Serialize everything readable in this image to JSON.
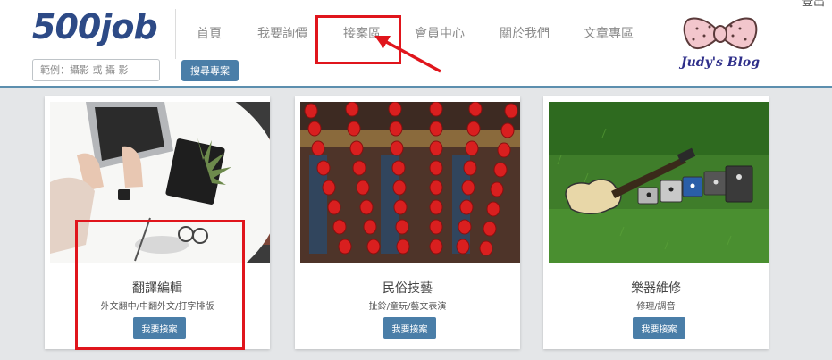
{
  "header": {
    "logo": "500job",
    "corner_text": "登出",
    "search": {
      "placeholder": "範例：攝影 或 攝 影",
      "button_label": "搜尋專案"
    },
    "nav": [
      {
        "label": "首頁"
      },
      {
        "label": "我要詢價"
      },
      {
        "label": "接案區"
      },
      {
        "label": "會員中心"
      },
      {
        "label": "關於我們"
      },
      {
        "label": "文章專區"
      }
    ],
    "blog_logo_text": "Judy's Blog"
  },
  "cards": [
    {
      "title": "翻譯編輯",
      "subtitle": "外文翻中/中翻外文/打字排版",
      "button": "我要接案",
      "image": "laptop-typing-photo"
    },
    {
      "title": "民俗技藝",
      "subtitle": "扯鈴/童玩/藝文表演",
      "button": "我要接案",
      "image": "red-lanterns-photo"
    },
    {
      "title": "樂器維修",
      "subtitle": "修理/調音",
      "button": "我要接案",
      "image": "guitar-on-grass-photo"
    }
  ],
  "colors": {
    "accent": "#4a7ea8",
    "logo": "#2d4a86",
    "annotation": "#e0151c",
    "nav_text": "#8a8a8a"
  }
}
